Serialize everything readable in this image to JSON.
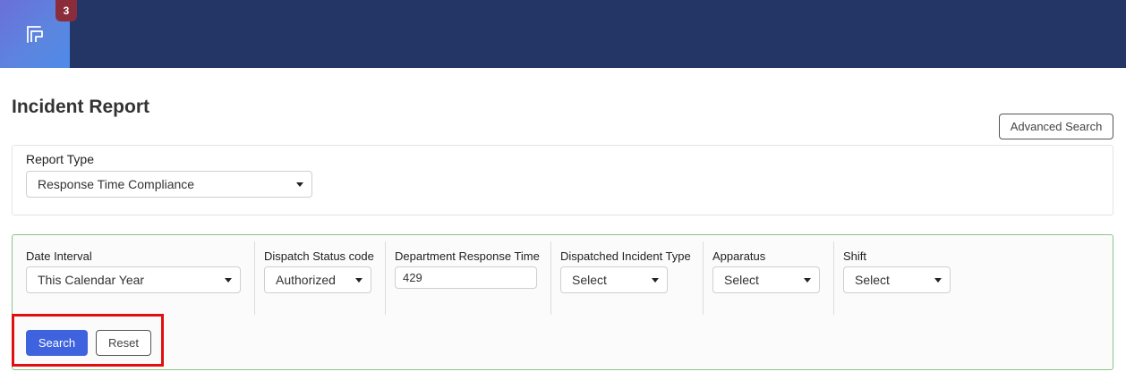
{
  "header": {
    "badge_count": "3",
    "logo_icon": "document-form-icon"
  },
  "page": {
    "title": "Incident Report",
    "advanced_search_label": "Advanced Search"
  },
  "report_type": {
    "label": "Report Type",
    "selected": "Response Time Compliance"
  },
  "filters": {
    "date_interval": {
      "label": "Date Interval",
      "selected": "This Calendar Year"
    },
    "dispatch_status": {
      "label": "Dispatch Status code",
      "selected": "Authorized"
    },
    "department_response_time": {
      "label": "Department Response Time",
      "value": "429"
    },
    "dispatched_incident_type": {
      "label": "Dispatched Incident Type",
      "selected": "Select"
    },
    "apparatus": {
      "label": "Apparatus",
      "selected": "Select"
    },
    "shift": {
      "label": "Shift",
      "selected": "Select"
    }
  },
  "actions": {
    "search_label": "Search",
    "reset_label": "Reset"
  },
  "colors": {
    "topbar": "#243666",
    "primary": "#3f62de",
    "badge": "#8b2c3a",
    "highlight": "#e01010",
    "panel_border": "#8cc48a"
  }
}
